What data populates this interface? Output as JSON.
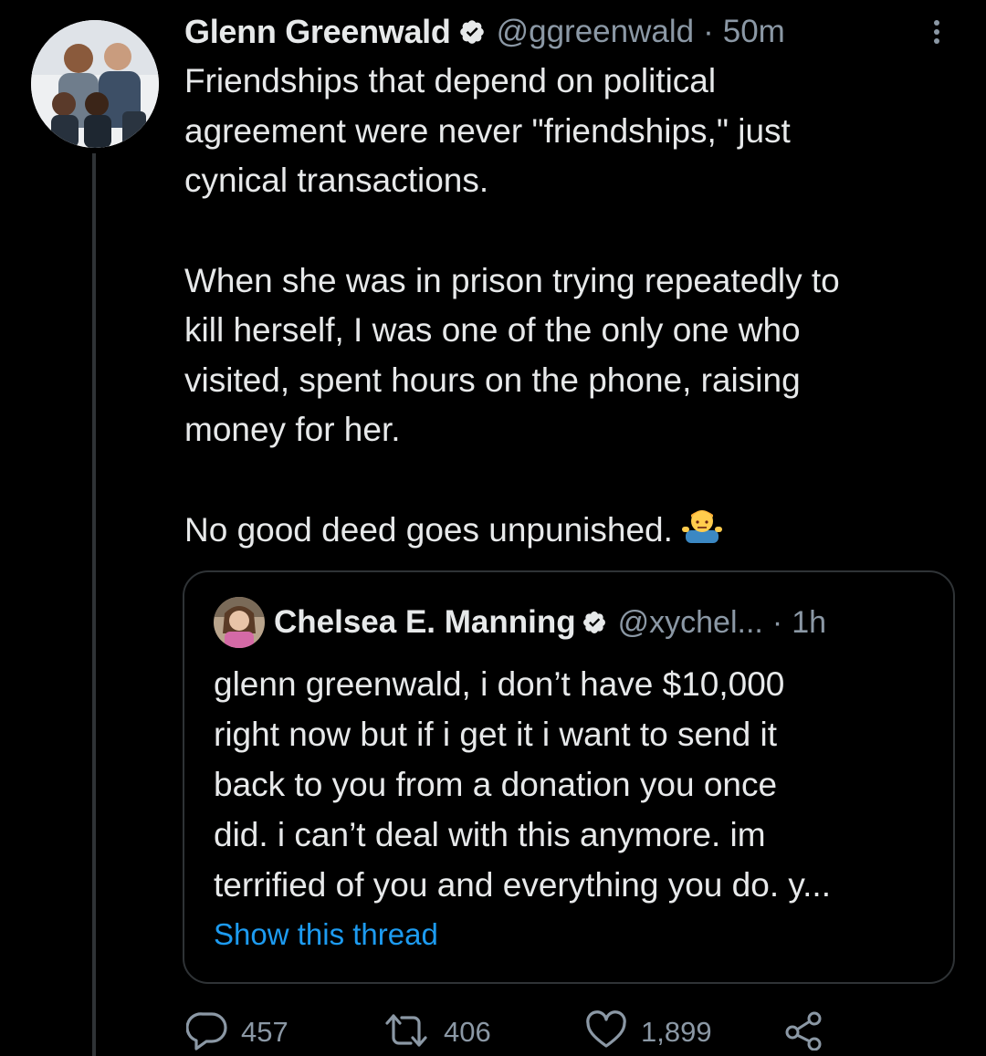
{
  "tweet": {
    "author": {
      "display_name": "Glenn Greenwald",
      "handle": "@ggreenwald",
      "verified": true,
      "avatar": "profile-photo"
    },
    "time": "50m",
    "separator": "·",
    "menu_icon": "more-vertical-icon",
    "lines": [
      "Friendships that depend on political",
      "agreement were never \"friendships,\" just",
      "cynical transactions.",
      "When she was in prison trying repeatedly to",
      "kill herself, I was one of the only one who",
      "visited, spent hours on the phone, raising",
      "money for her.",
      "No good deed goes unpunished."
    ],
    "emoji": "man-shrugging-emoji"
  },
  "quote": {
    "author": {
      "display_name": "Chelsea E. Manning",
      "handle": "@xychel...",
      "verified": true,
      "avatar": "profile-photo"
    },
    "separator": "·",
    "time": "1h",
    "lines": [
      "glenn greenwald, i don’t have $10,000",
      "right now but if i get it i want to send it",
      "back to you from a donation you once",
      "did. i can’t deal with this anymore. im",
      "terrified of you and everything you do. y..."
    ],
    "show_thread": "Show this thread"
  },
  "actions": {
    "reply": {
      "icon": "reply-icon",
      "count": "457"
    },
    "retweet": {
      "icon": "retweet-icon",
      "count": "406"
    },
    "like": {
      "icon": "heart-icon",
      "count": "1,899"
    },
    "share": {
      "icon": "share-icon"
    }
  },
  "colors": {
    "background": "#000000",
    "text_primary": "#e7e9ea",
    "text_secondary": "#8b98a5",
    "link": "#1d9bf0",
    "border": "#2f3336"
  }
}
